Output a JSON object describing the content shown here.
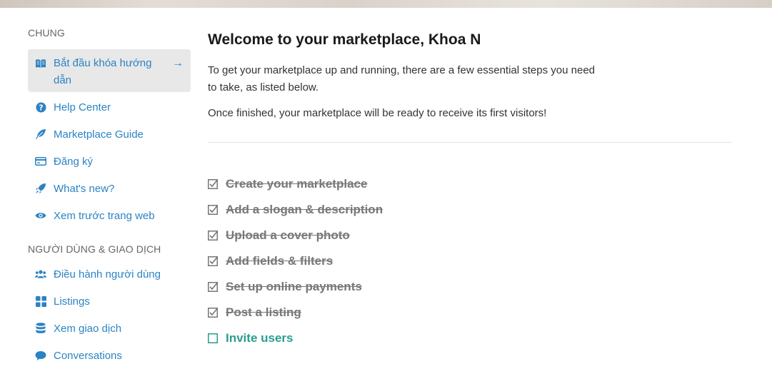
{
  "sidebar": {
    "sections": [
      {
        "title": "CHUNG"
      },
      {
        "title": "NGƯỜI DÙNG & GIAO DỊCH"
      }
    ],
    "general_items": [
      {
        "label": "Bắt đầu khóa hướng dẫn",
        "icon": "book-open-icon",
        "arrow": "→"
      },
      {
        "label": "Help Center",
        "icon": "question-circle-icon"
      },
      {
        "label": "Marketplace Guide",
        "icon": "feather-icon"
      },
      {
        "label": "Đăng ký",
        "icon": "credit-card-icon"
      },
      {
        "label": "What's new?",
        "icon": "rocket-icon"
      },
      {
        "label": "Xem trước trang web",
        "icon": "eye-icon"
      }
    ],
    "users_items": [
      {
        "label": "Điều hành người dùng",
        "icon": "users-icon"
      },
      {
        "label": "Listings",
        "icon": "grid-icon"
      },
      {
        "label": "Xem giao dịch",
        "icon": "database-icon"
      },
      {
        "label": "Conversations",
        "icon": "chat-bubble-icon"
      }
    ]
  },
  "main": {
    "title": "Welcome to your marketplace, Khoa N",
    "intro": "To get your marketplace up and running, there are a few essential steps you need to take, as listed below.",
    "finished": "Once finished, your marketplace will be ready to receive its first visitors!",
    "checklist": [
      {
        "label": "Create your marketplace",
        "done": true
      },
      {
        "label": "Add a slogan & description",
        "done": true
      },
      {
        "label": "Upload a cover photo",
        "done": true
      },
      {
        "label": "Add fields & filters",
        "done": true
      },
      {
        "label": "Set up online payments",
        "done": true
      },
      {
        "label": "Post a listing",
        "done": true
      },
      {
        "label": "Invite users",
        "done": false
      }
    ]
  },
  "colors": {
    "link": "#2b83c3",
    "done": "#777777",
    "todo": "#2a9d8f",
    "active_bg": "#e8e8e8"
  }
}
